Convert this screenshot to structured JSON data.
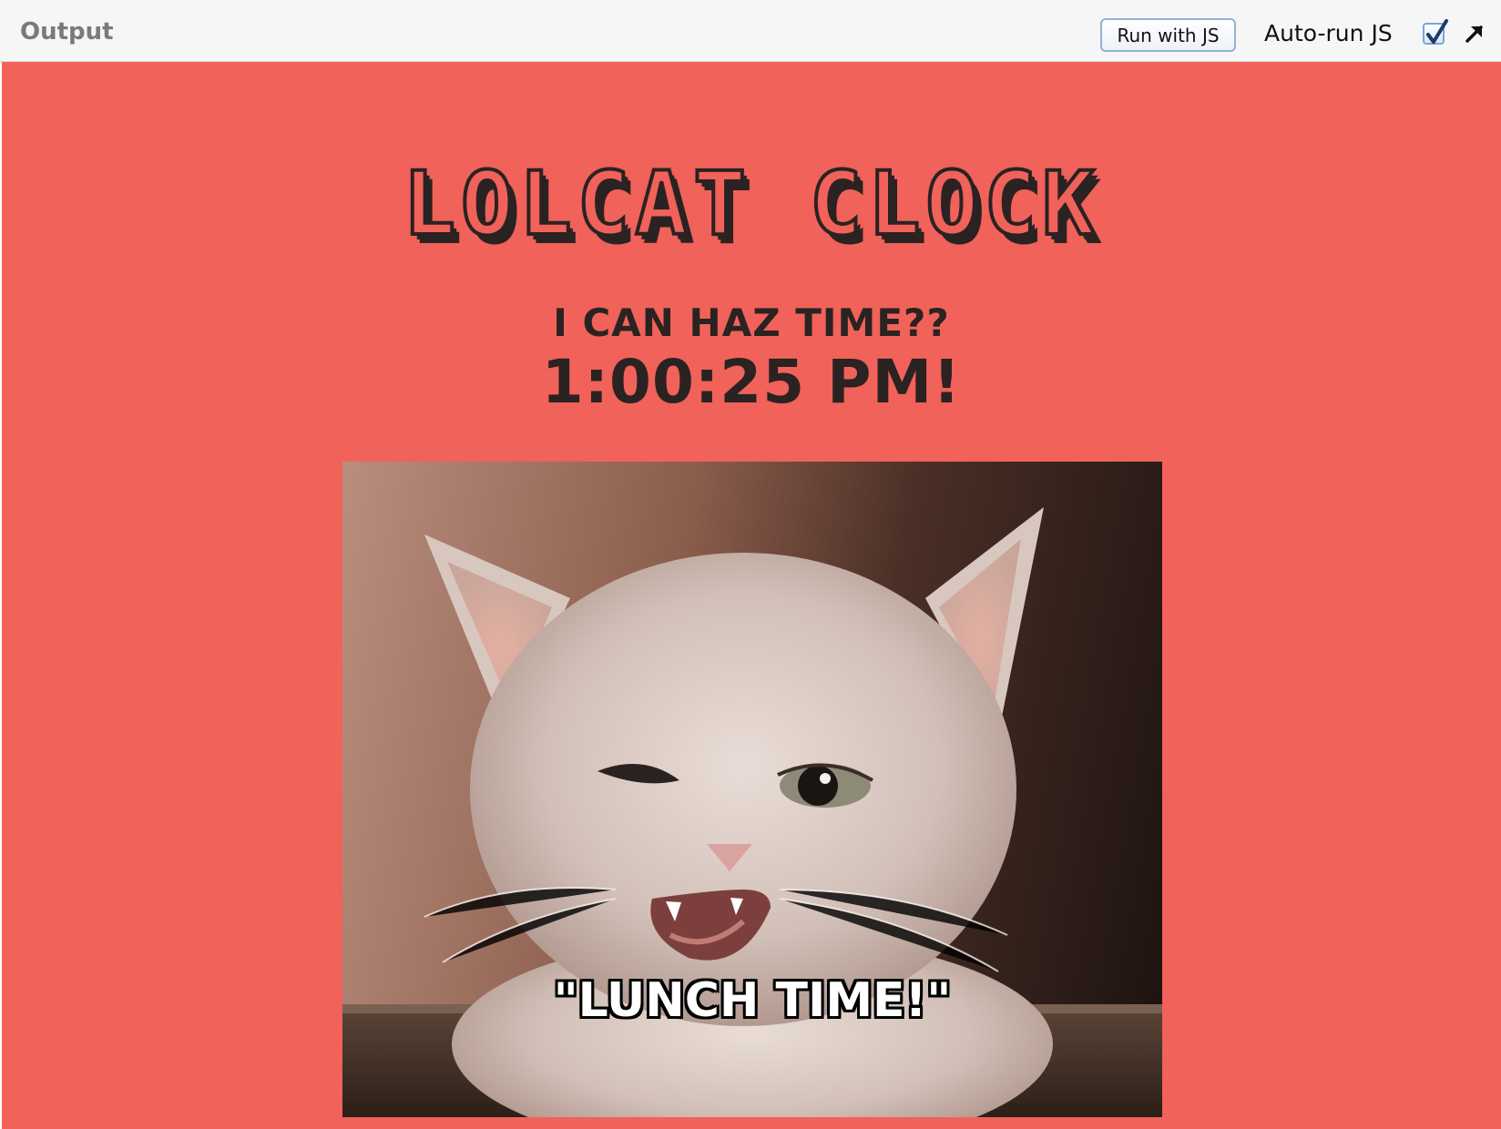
{
  "toolbar": {
    "output_label": "Output",
    "run_button_label": "Run with JS",
    "autorun_label": "Auto-run JS",
    "autorun_checked": true,
    "popout_icon": "arrow-up-right-icon"
  },
  "page": {
    "background_color": "#f0625a",
    "title": "LOLCAT CLOCK",
    "subtitle": "I CAN HAZ TIME??",
    "time": "1:00:25 PM!",
    "image": {
      "description_icon": "lolcat-photo",
      "caption": "\"LUNCH TIME!\""
    }
  }
}
